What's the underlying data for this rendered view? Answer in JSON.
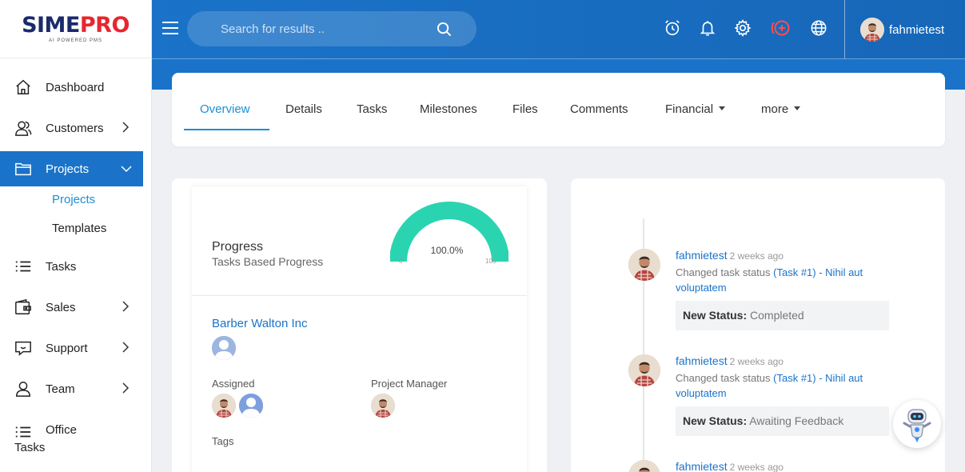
{
  "brand": {
    "name_part1": "SIME",
    "name_part2": "PRO",
    "tagline": "AI POWERED PMS",
    "color_primary": "#1a2a6c",
    "color_accent": "#e8252e"
  },
  "header": {
    "search_placeholder": "Search for results ..",
    "icons": [
      "menu-icon",
      "search-icon",
      "alarm-clock-icon",
      "bell-icon",
      "gear-icon",
      "add-circle-icon",
      "globe-icon"
    ],
    "user_name": "fahmietest",
    "accent": "#1a73c9"
  },
  "sidebar": {
    "items": [
      {
        "label": "Dashboard",
        "icon": "home-icon"
      },
      {
        "label": "Customers",
        "icon": "users-icon"
      },
      {
        "label": "Projects",
        "icon": "folder-icon",
        "active": true
      },
      {
        "label": "Tasks",
        "icon": "list-icon"
      },
      {
        "label": "Sales",
        "icon": "wallet-icon"
      },
      {
        "label": "Support",
        "icon": "chat-icon"
      },
      {
        "label": "Team",
        "icon": "user-icon"
      }
    ],
    "sub_items": [
      {
        "label": "Projects",
        "active": true
      },
      {
        "label": "Templates"
      }
    ],
    "office": {
      "line1": "Office",
      "line2": "Tasks"
    }
  },
  "tabs": [
    "Overview",
    "Details",
    "Tasks",
    "Milestones",
    "Files",
    "Comments",
    "Financial",
    "more"
  ],
  "progress": {
    "title": "Progress",
    "subtitle": "Tasks Based Progress",
    "value_label": "100.0%",
    "value": 100,
    "min_label": "0",
    "max_label": "100",
    "gauge_color": "#2bd4b0"
  },
  "project": {
    "customer": "Barber Walton Inc",
    "assigned_label": "Assigned",
    "manager_label": "Project Manager",
    "tags_label": "Tags"
  },
  "activity": [
    {
      "user": "fahmietest",
      "time": "2 weeks ago",
      "action": "Changed task status",
      "link": "(Task #1) - Nihil aut voluptatem",
      "status_label": "New Status:",
      "status_value": "Completed"
    },
    {
      "user": "fahmietest",
      "time": "2 weeks ago",
      "action": "Changed task status",
      "link": "(Task #1) - Nihil aut voluptatem",
      "status_label": "New Status:",
      "status_value": "Awaiting Feedback"
    },
    {
      "user": "fahmietest",
      "time": "2 weeks ago"
    }
  ]
}
